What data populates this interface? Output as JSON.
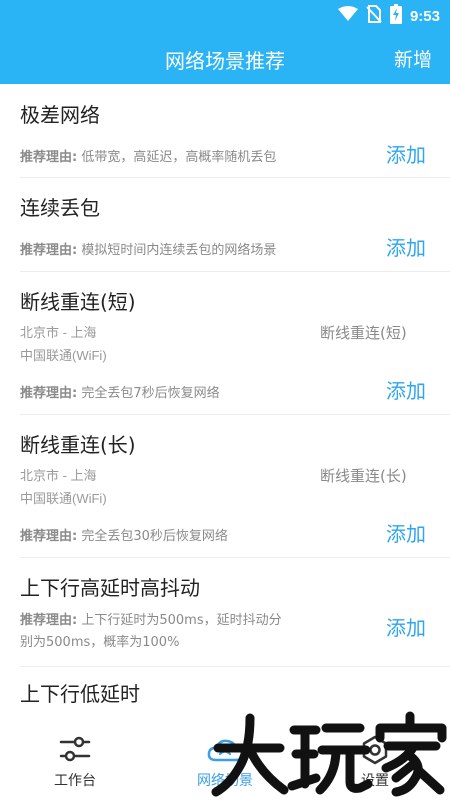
{
  "status_bar": {
    "time": "9:53",
    "icons": [
      "wifi-icon",
      "no-sim-icon",
      "battery-charging-icon"
    ]
  },
  "header": {
    "title": "网络场景推荐",
    "action": "新增"
  },
  "reason_label": "推荐理由:",
  "add_label": "添加",
  "scenes": [
    {
      "title": "极差网络",
      "reason": "低带宽，高延迟，高概率随机丢包"
    },
    {
      "title": "连续丢包",
      "reason": "模拟短时间内连续丢包的网络场景"
    },
    {
      "title": "断线重连(短)",
      "route": "北京市 - 上海",
      "carrier": "中国联通(WiFi)",
      "mode": "断线重连(短)",
      "reason": "完全丢包7秒后恢复网络"
    },
    {
      "title": "断线重连(长)",
      "route": "北京市 - 上海",
      "carrier": "中国联通(WiFi)",
      "mode": "断线重连(长)",
      "reason": "完全丢包30秒后恢复网络"
    },
    {
      "title": "上下行高延时高抖动",
      "reason_line1": "上下行延时为500ms，延时抖动分",
      "reason_line2": "别为500ms，概率为100%"
    },
    {
      "title": "上下行低延时"
    }
  ],
  "bottom_nav": [
    {
      "label": "工作台",
      "icon": "sliders-icon",
      "active": false
    },
    {
      "label": "网络场景",
      "icon": "cloud-icon",
      "active": true
    },
    {
      "label": "设置",
      "icon": "settings-icon",
      "active": false
    }
  ],
  "watermark": {
    "text": "大玩家",
    "icon": "watermark-logo"
  },
  "colors": {
    "primary": "#2ab3f5",
    "accent": "#2ea6f0",
    "text_secondary": "#8a8a8a",
    "divider": "#ececec"
  }
}
